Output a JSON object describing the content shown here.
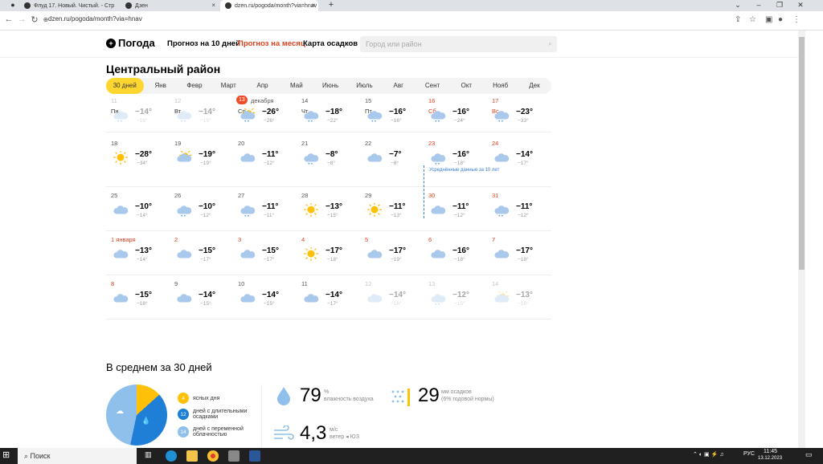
{
  "browser": {
    "tabs": [
      {
        "title": "Флуд 17. Новый. Чистый. - Стр",
        "active": false
      },
      {
        "title": "Дзен",
        "active": false
      },
      {
        "title": "dzen.ru/pogoda/month?via=hnav",
        "active": true
      }
    ],
    "new_tab": "+",
    "url": "dzen.ru/pogoda/month?via=hnav"
  },
  "header": {
    "logo": "Погода",
    "nav": [
      "Прогноз на 10 дней",
      "Прогноз на месяц",
      "Карта осадков"
    ],
    "search_placeholder": "Город или район"
  },
  "page_title": "Центральный район",
  "months": [
    "30 дней",
    "Янв",
    "Февр",
    "Март",
    "Апр",
    "Май",
    "Июнь",
    "Июль",
    "Авг",
    "Сент",
    "Окт",
    "Нояб",
    "Дек"
  ],
  "weekdays": [
    "Пн",
    "Вт",
    "Ср",
    "Чт",
    "Пт",
    "Сб",
    "Вс"
  ],
  "today_badge": "13",
  "today_month": "декабря",
  "avg_note": "Усреднённые данные за 10 лет",
  "calendar": [
    [
      {
        "d": "11",
        "hi": "−14°",
        "lo": "−16°",
        "icon": "snow",
        "past": true
      },
      {
        "d": "12",
        "hi": "−14°",
        "lo": "−15°",
        "icon": "snow",
        "past": true
      },
      {
        "d": "",
        "hi": "−26°",
        "lo": "−26°",
        "icon": "sun-snow",
        "today": true
      },
      {
        "d": "14",
        "hi": "−18°",
        "lo": "−22°",
        "icon": "snow"
      },
      {
        "d": "15",
        "hi": "−16°",
        "lo": "−16°",
        "icon": "snow"
      },
      {
        "d": "16",
        "hi": "−16°",
        "lo": "−24°",
        "icon": "snow",
        "red": true
      },
      {
        "d": "17",
        "hi": "−23°",
        "lo": "−33°",
        "icon": "snow",
        "red": true
      }
    ],
    [
      {
        "d": "18",
        "hi": "−28°",
        "lo": "−34°",
        "icon": "sun"
      },
      {
        "d": "19",
        "hi": "−19°",
        "lo": "−19°",
        "icon": "sun-cloud"
      },
      {
        "d": "20",
        "hi": "−11°",
        "lo": "−12°",
        "icon": "cloud"
      },
      {
        "d": "21",
        "hi": "−8°",
        "lo": "−8°",
        "icon": "snow"
      },
      {
        "d": "22",
        "hi": "−7°",
        "lo": "−8°",
        "icon": "cloud"
      },
      {
        "d": "23",
        "hi": "−16°",
        "lo": "−18°",
        "icon": "snow",
        "red": true
      },
      {
        "d": "24",
        "hi": "−14°",
        "lo": "−17°",
        "icon": "cloud",
        "red": true
      }
    ],
    [
      {
        "d": "25",
        "hi": "−10°",
        "lo": "−14°",
        "icon": "cloud"
      },
      {
        "d": "26",
        "hi": "−10°",
        "lo": "−12°",
        "icon": "snow"
      },
      {
        "d": "27",
        "hi": "−11°",
        "lo": "−11°",
        "icon": "snow"
      },
      {
        "d": "28",
        "hi": "−13°",
        "lo": "−15°",
        "icon": "sun"
      },
      {
        "d": "29",
        "hi": "−11°",
        "lo": "−13°",
        "icon": "sun"
      },
      {
        "d": "30",
        "hi": "−11°",
        "lo": "−12°",
        "icon": "cloud",
        "red": true
      },
      {
        "d": "31",
        "hi": "−11°",
        "lo": "−12°",
        "icon": "snow",
        "red": true
      }
    ],
    [
      {
        "d": "1 января",
        "hi": "−13°",
        "lo": "−14°",
        "icon": "cloud",
        "red": true
      },
      {
        "d": "2",
        "hi": "−15°",
        "lo": "−17°",
        "icon": "cloud",
        "red": true
      },
      {
        "d": "3",
        "hi": "−15°",
        "lo": "−17°",
        "icon": "cloud",
        "red": true
      },
      {
        "d": "4",
        "hi": "−17°",
        "lo": "−18°",
        "icon": "sun",
        "red": true
      },
      {
        "d": "5",
        "hi": "−17°",
        "lo": "−19°",
        "icon": "cloud",
        "red": true
      },
      {
        "d": "6",
        "hi": "−16°",
        "lo": "−18°",
        "icon": "cloud",
        "red": true
      },
      {
        "d": "7",
        "hi": "−17°",
        "lo": "−18°",
        "icon": "cloud",
        "red": true
      }
    ],
    [
      {
        "d": "8",
        "hi": "−15°",
        "lo": "−18°",
        "icon": "cloud",
        "red": true
      },
      {
        "d": "9",
        "hi": "−14°",
        "lo": "−15°",
        "icon": "cloud"
      },
      {
        "d": "10",
        "hi": "−14°",
        "lo": "−15°",
        "icon": "cloud"
      },
      {
        "d": "11",
        "hi": "−14°",
        "lo": "−17°",
        "icon": "cloud"
      },
      {
        "d": "12",
        "hi": "−14°",
        "lo": "−16°",
        "icon": "cloud",
        "past": true
      },
      {
        "d": "13",
        "hi": "−12°",
        "lo": "−15°",
        "icon": "snow",
        "past": true
      },
      {
        "d": "14",
        "hi": "−13°",
        "lo": "−16°",
        "icon": "sun-cloud",
        "past": true
      }
    ]
  ],
  "summary": {
    "title": "В среднем за 30 дней",
    "legend": [
      {
        "n": "4",
        "label": "ясных дня",
        "color": "#ffc107"
      },
      {
        "n": "12",
        "label": "дней с длительными осадками",
        "color": "#1f7ed6"
      },
      {
        "n": "14",
        "label": "дней с переменной облачностью",
        "color": "#8ec0eb"
      }
    ],
    "humidity_value": "79",
    "humidity_unit": "%",
    "humidity_label": "влажность воздуха",
    "precip_value": "29",
    "precip_unit": "мм осадков",
    "precip_note": "(6% годовой нормы)",
    "wind_value": "4,3",
    "wind_unit": "м/с",
    "wind_label": "ветер ◂ ЮЗ"
  },
  "taskbar": {
    "search": "Поиск",
    "lang": "РУС",
    "time": "11:45",
    "date": "13.12.2023"
  }
}
